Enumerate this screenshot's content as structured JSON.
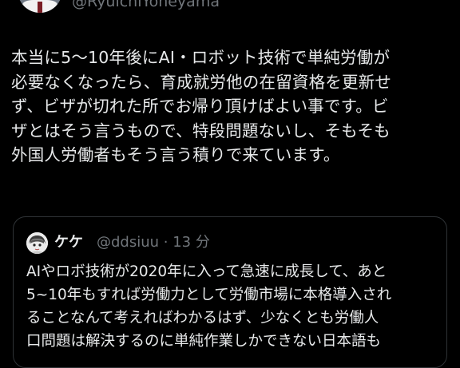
{
  "author": {
    "handle": "@RyuichiYoneyama",
    "avatar_icon": "profile-photo-icon"
  },
  "tweet": {
    "lines": [
      "本当に5〜10年後にAI・ロボット技術で単純労働が",
      "必要なくなったら、育成就労他の在留資格を更新せ",
      "ず、ビザが切れた所でお帰り頂けばよい事です。ビ",
      "ザとはそう言うもので、特段問題ないし、そもそも",
      "外国人労働者もそう言う積りで来ています。"
    ]
  },
  "quote": {
    "avatar_icon": "anime-avatar-icon",
    "name": "ケケ",
    "handle_time": "@ddsiuu · 13 分",
    "lines": [
      "AIやロボ技術が2020年に入って急速に成長して、あと",
      "5~10年もすれば労働力として労働市場に本格導入され",
      "ることなんて考えればわかるはず、少なくとも労働人",
      "口問題は解決するのに単純作業しかできない日本語も"
    ]
  },
  "colors": {
    "background": "#000000",
    "text": "#e7e9ea",
    "secondary_text": "#71767b",
    "card_border": "#2f3336"
  }
}
